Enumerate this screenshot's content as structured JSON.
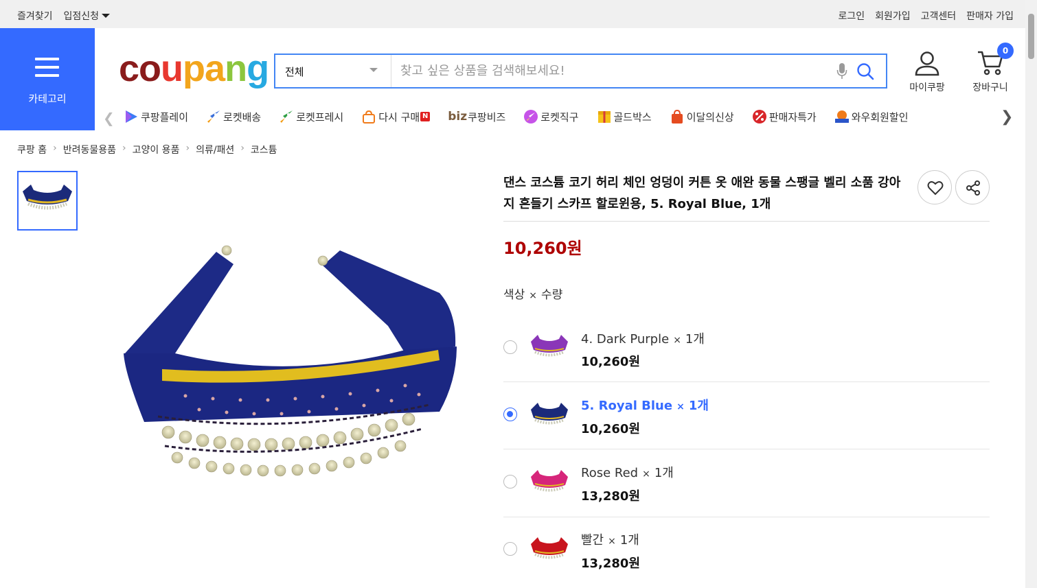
{
  "topbar": {
    "bookmark": "즐겨찾기",
    "vendor_apply": "입점신청",
    "login": "로그인",
    "signup": "회원가입",
    "customer_center": "고객센터",
    "seller_signup": "판매자 가입"
  },
  "category_button": {
    "label": "카테고리"
  },
  "logo": {
    "p1": "co",
    "p2": "u",
    "p3": "pa",
    "p4": "n",
    "p5": "g"
  },
  "search": {
    "scope": "전체",
    "placeholder": "찾고 싶은 상품을 검색해보세요!"
  },
  "header_actions": {
    "mycoupang": "마이쿠팡",
    "cart": "장바구니",
    "cart_count": "0"
  },
  "shortcuts": [
    {
      "label": "쿠팡플레이",
      "icon": "play-icon"
    },
    {
      "label": "로켓배송",
      "icon": "rocket-icon"
    },
    {
      "label": "로켓프레시",
      "icon": "rocket-fresh-icon"
    },
    {
      "label": "다시 구매",
      "icon": "rebuy-bag-icon",
      "badge": "N"
    },
    {
      "label": "쿠팡비즈",
      "icon": "biz-icon",
      "prefix": "biz"
    },
    {
      "label": "로켓직구",
      "icon": "rocket-global-icon"
    },
    {
      "label": "골드박스",
      "icon": "goldbox-icon"
    },
    {
      "label": "이달의신상",
      "icon": "new-bag-icon"
    },
    {
      "label": "판매자특가",
      "icon": "percent-icon"
    },
    {
      "label": "와우회원할인",
      "icon": "wow-icon"
    }
  ],
  "breadcrumb": [
    "쿠팡 홈",
    "반려동물용품",
    "고양이 용품",
    "의류/패션",
    "코스튬"
  ],
  "product": {
    "title": "댄스 코스튬 코기 허리 체인 엉덩이 커튼 옷 애완 동물 스팽글 벨리 소품 강아지 흔들기 스카프 할로윈용, 5. Royal Blue, 1개",
    "price": "10,260원",
    "option_header": {
      "a": "색상",
      "x": "×",
      "b": "수량"
    }
  },
  "options": [
    {
      "name": "4. Dark Purple",
      "qty": "1개",
      "price": "10,260원",
      "selected": false,
      "color": "#7a2d9e"
    },
    {
      "name": "5. Royal Blue",
      "qty": "1개",
      "price": "10,260원",
      "selected": true,
      "color": "#1b2a7a"
    },
    {
      "name": "Rose Red",
      "qty": "1개",
      "price": "13,280원",
      "selected": false,
      "color": "#d6257a"
    },
    {
      "name": "빨간",
      "qty": "1개",
      "price": "13,280원",
      "selected": false,
      "color": "#c8141e"
    }
  ],
  "colors": {
    "accent": "#346aff",
    "price": "#ae0000",
    "selected_option": "#346aff"
  }
}
